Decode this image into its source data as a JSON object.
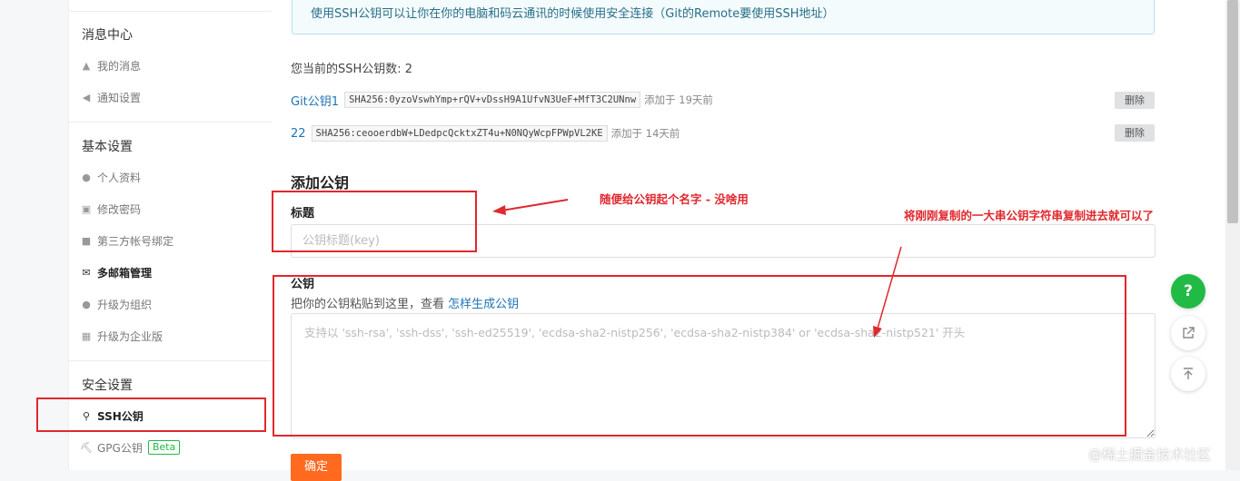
{
  "sidebar": {
    "messages": {
      "title": "消息中心",
      "items": [
        {
          "label": "我的消息",
          "icon": "bell-icon"
        },
        {
          "label": "通知设置",
          "icon": "volume-icon"
        }
      ]
    },
    "basic": {
      "title": "基本设置",
      "items": [
        {
          "label": "个人资料",
          "icon": "user-icon"
        },
        {
          "label": "修改密码",
          "icon": "lock-icon"
        },
        {
          "label": "第三方帐号绑定",
          "icon": "bind-icon"
        },
        {
          "label": "多邮箱管理",
          "icon": "mail-icon"
        },
        {
          "label": "升级为组织",
          "icon": "group-icon"
        },
        {
          "label": "升级为企业版",
          "icon": "building-icon"
        }
      ]
    },
    "security": {
      "title": "安全设置",
      "items": [
        {
          "label": "SSH公钥",
          "icon": "key-icon"
        },
        {
          "label": "GPG公钥",
          "icon": "gpg-icon",
          "badge": "Beta"
        }
      ]
    }
  },
  "main": {
    "info": "使用SSH公钥可以让你在你的电脑和码云通讯的时候使用安全连接（Git的Remote要使用SSH地址）",
    "count_text": "您当前的SSH公钥数: 2",
    "keys": [
      {
        "name": "Git公钥1",
        "fingerprint": "SHA256:0yzoVswhYmp+rQV+vDssH9A1UfvN3UeF+MfT3C2UNnw",
        "added": "添加于 19天前",
        "delete_label": "删除"
      },
      {
        "name": "22",
        "fingerprint": "SHA256:ceooerdbW+LDedpcQcktxZT4u+N0NQyWcpFPWpVL2KE",
        "added": "添加于 14天前",
        "delete_label": "删除"
      }
    ],
    "add_heading": "添加公钥",
    "title_label": "标题",
    "title_placeholder": "公钥标题(key)",
    "key_label": "公钥",
    "key_hint": "把你的公钥粘贴到这里，查看",
    "key_hint_link": "怎样生成公钥",
    "key_placeholder": "支持以 'ssh-rsa', 'ssh-dss', 'ssh-ed25519', 'ecdsa-sha2-nistp256', 'ecdsa-sha2-nistp384' or 'ecdsa-sha2-nistp521' 开头",
    "submit_label": "确定"
  },
  "annotations": {
    "title_note": "随便给公钥起个名字 - 没啥用",
    "key_note": "将刚刚复制的一大串公钥字符串复制进去就可以了",
    "color": "#e0282e"
  },
  "floating": {
    "help_label": "?",
    "icons": [
      "question-icon",
      "share-icon",
      "back-to-top-icon"
    ]
  },
  "watermark": "@稀土掘金技术社区"
}
